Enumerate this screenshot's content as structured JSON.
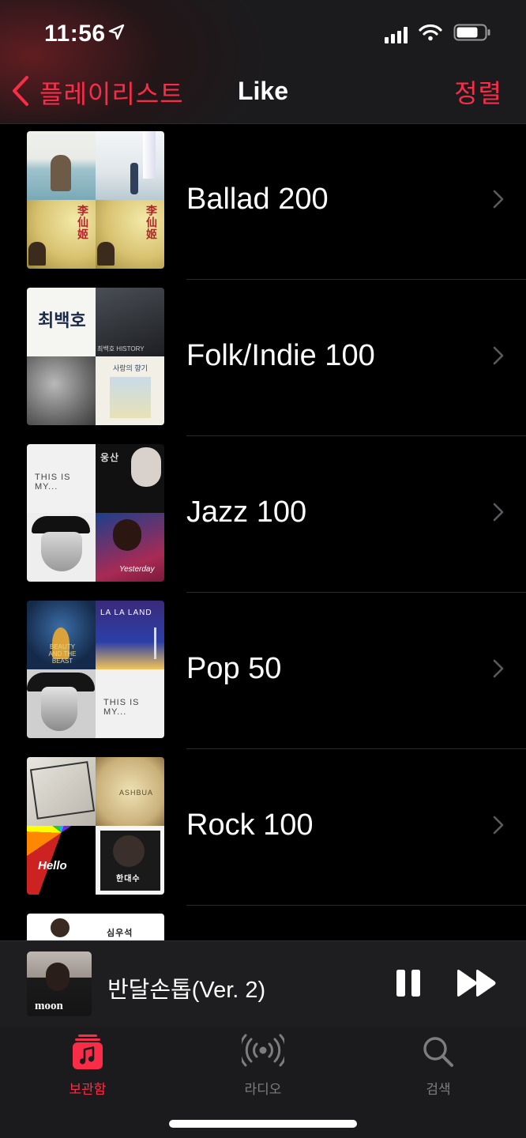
{
  "status": {
    "time": "11:56"
  },
  "nav": {
    "back_label": "플레이리스트",
    "title": "Like",
    "sort_label": "정렬",
    "accent": "#fa2d48"
  },
  "playlists": [
    {
      "title": "Ballad 200",
      "art_texts": [
        "",
        "",
        "李仙姬",
        "李仙姬"
      ]
    },
    {
      "title": "Folk/Indie 100",
      "art_texts": [
        "최백호",
        "최백호 HISTORY",
        "",
        "사랑의 향기"
      ]
    },
    {
      "title": "Jazz 100",
      "art_texts": [
        "THIS IS MY...",
        "웅산",
        "",
        "Yesterday"
      ]
    },
    {
      "title": "Pop 50",
      "art_texts": [
        "BEAUTY AND THE BEAST",
        "LA LA LAND",
        "",
        "THIS IS MY..."
      ]
    },
    {
      "title": "Rock 100",
      "art_texts": [
        "",
        "ASHBUA",
        "Hello",
        "한대수"
      ]
    },
    {
      "title": "",
      "art_texts": [
        "",
        "심우석",
        "",
        ""
      ]
    }
  ],
  "now_playing": {
    "title": "반달손톱(Ver. 2)",
    "art_text": "moon"
  },
  "tabs": [
    {
      "label": "보관함",
      "icon": "library-icon",
      "active": true
    },
    {
      "label": "라디오",
      "icon": "radio-icon",
      "active": false
    },
    {
      "label": "검색",
      "icon": "search-icon",
      "active": false
    }
  ]
}
